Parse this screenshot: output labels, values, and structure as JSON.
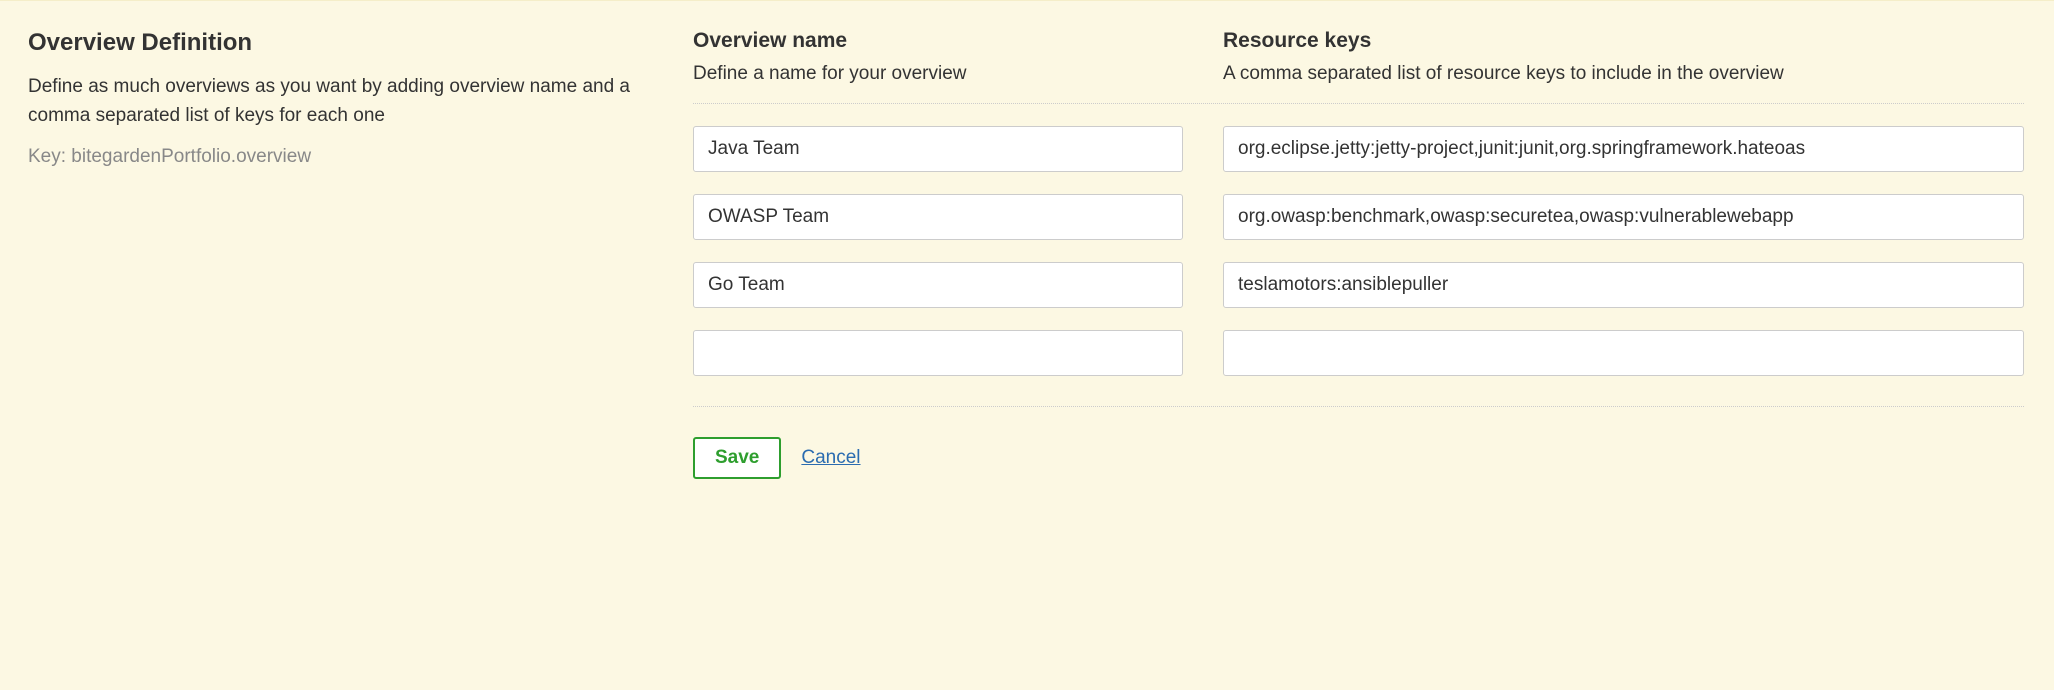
{
  "section": {
    "title": "Overview Definition",
    "description": "Define as much overviews as you want by adding overview name and a comma separated list of keys for each one",
    "keyLabel": "Key: bitegardenPortfolio.overview"
  },
  "columns": {
    "name": {
      "title": "Overview name",
      "description": "Define a name for your overview"
    },
    "keys": {
      "title": "Resource keys",
      "description": "A comma separated list of resource keys to include in the overview"
    }
  },
  "rows": [
    {
      "name": "Java Team",
      "keys": "org.eclipse.jetty:jetty-project,junit:junit,org.springframework.hateoas"
    },
    {
      "name": "OWASP Team",
      "keys": "org.owasp:benchmark,owasp:securetea,owasp:vulnerablewebapp"
    },
    {
      "name": "Go Team",
      "keys": "teslamotors:ansiblepuller"
    },
    {
      "name": "",
      "keys": ""
    }
  ],
  "actions": {
    "save": "Save",
    "cancel": "Cancel"
  }
}
